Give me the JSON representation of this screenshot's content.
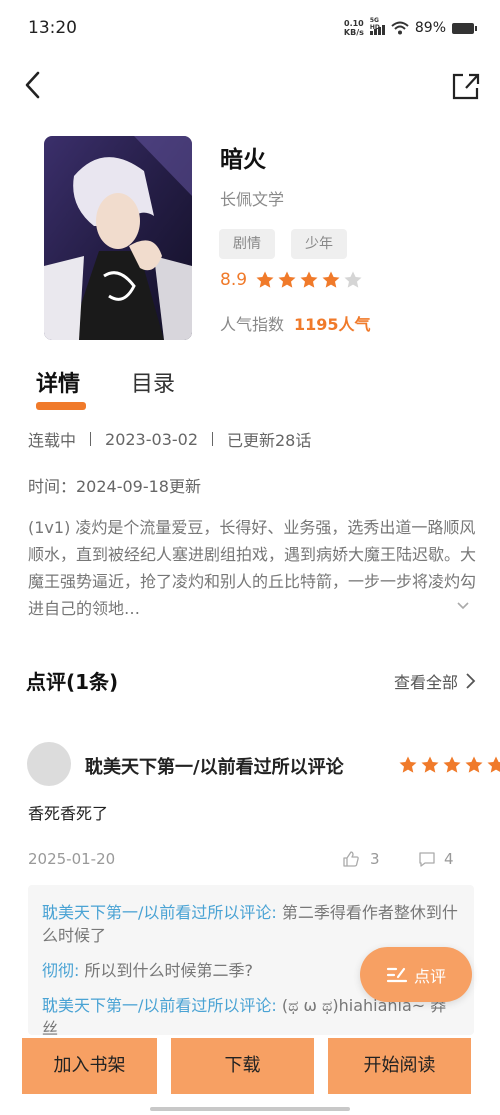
{
  "status_bar": {
    "time": "13:20",
    "net_speed_value": "0.10",
    "net_speed_unit": "KB/s",
    "signal_label": "5G HD",
    "battery": "89%"
  },
  "nav": {
    "back_icon": "chevron-left-icon",
    "share_icon": "share-external-icon"
  },
  "book": {
    "title": "暗火",
    "author": "长佩文学",
    "tags": [
      "剧情",
      "少年"
    ],
    "rating": "8.9",
    "rating_stars": 4,
    "rating_max": 5,
    "popularity_label": "人气指数",
    "popularity_value": "1195人气"
  },
  "tabs": {
    "detail": "详情",
    "toc": "目录"
  },
  "detail": {
    "status": "连载中",
    "start_date": "2023-03-02",
    "updated": "已更新28话",
    "time_line": "时间：2024-09-18更新",
    "synopsis": "(1v1) 凌灼是个流量爱豆，长得好、业务强，选秀出道一路顺风顺水，直到被经纪人塞进剧组拍戏，遇到病娇大魔王陆迟歇。大魔王强势逼近，抢了凌灼和别人的丘比特箭，一步一步将凌灼勾进自己的领地…"
  },
  "reviews": {
    "header": "点评(1条)",
    "view_all": "查看全部",
    "items": [
      {
        "name": "耽美天下第一/以前看过所以评论",
        "stars": 5,
        "text": "香死香死了",
        "date": "2025-01-20",
        "likes": "3",
        "comments": "4",
        "replies": [
          {
            "user": "耽美天下第一/以前看过所以评论:",
            "text": " 第二季得看作者整休到什么时候了"
          },
          {
            "user": "彻彻:",
            "text": " 所以到什么时候第二季?"
          },
          {
            "user": "耽美天下第一/以前看过所以评论:",
            "text": " (ಥ ω ಥ)hiahiahia~ 莽丝"
          }
        ]
      }
    ]
  },
  "fab": {
    "label": "点评",
    "icon": "comment-edit-icon"
  },
  "bottom_bar": {
    "shelf": "加入书架",
    "download": "下载",
    "read": "开始阅读"
  },
  "colors": {
    "accent": "#f07a2a",
    "button_bg": "#f7a063",
    "reply_user": "#4aa3d4"
  }
}
